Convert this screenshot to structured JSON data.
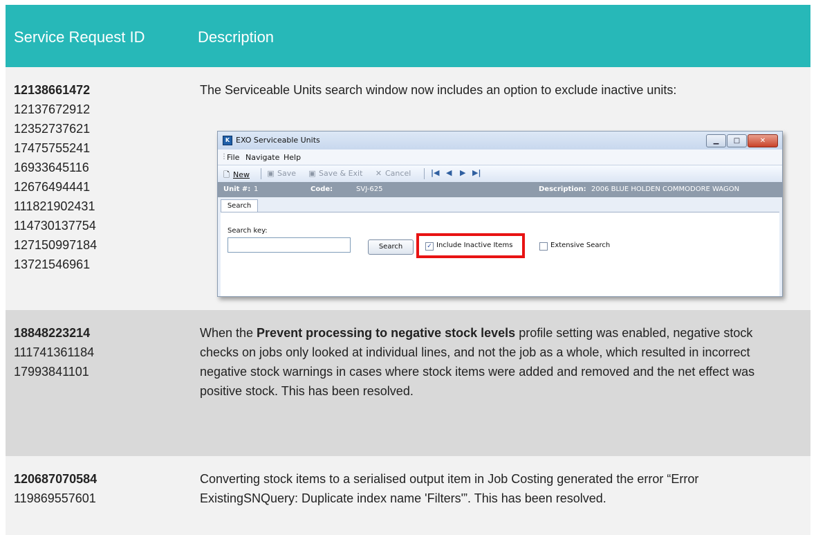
{
  "table": {
    "headers": [
      "Service Request ID",
      "Description"
    ],
    "rows": [
      {
        "ids_bold": "12138661472",
        "ids": [
          "12137672912",
          "12352737621",
          "17475755241",
          "16933645116",
          "12676494441",
          "111821902431",
          "114730137754",
          "127150997184",
          "13721546961"
        ],
        "description": "The Serviceable Units search window now includes an option to exclude inactive units:"
      },
      {
        "ids_bold": "18848223214",
        "ids": [
          "111741361184",
          "17993841101"
        ],
        "desc_before": "When the ",
        "desc_bold": "Prevent processing to negative stock levels",
        "desc_after": " profile setting was enabled, negative stock checks on jobs only looked at individual lines, and not the job as a whole, which resulted in incorrect negative stock warnings in cases where stock items were added and removed and the net effect was positive stock. This has been resolved."
      },
      {
        "ids_bold": "120687070584",
        "ids": [
          "119869557601"
        ],
        "description": "Converting stock items to a serialised output item in Job Costing generated the error “Error ExistingSNQuery: Duplicate index name 'Filters'”. This has been resolved."
      }
    ]
  },
  "window": {
    "title": "EXO Serviceable Units",
    "menu": [
      "File",
      "Navigate",
      "Help"
    ],
    "toolbar": {
      "new": "New",
      "save": "Save",
      "save_exit": "Save & Exit",
      "cancel": "Cancel"
    },
    "info": {
      "unit_label": "Unit #:",
      "unit_value": "1",
      "code_label": "Code:",
      "code_value": "SVJ-625",
      "desc_label": "Description:",
      "desc_value": "2006 BLUE HOLDEN COMMODORE WAGON"
    },
    "tab": "Search",
    "search_key_label": "Search key:",
    "search_button": "Search",
    "include_inactive": {
      "label": "Include Inactive Items",
      "checked": true
    },
    "extensive_search": {
      "label": "Extensive Search",
      "checked": false
    }
  },
  "colors": {
    "header_bg": "#27b8b8",
    "highlight": "#e81313"
  }
}
